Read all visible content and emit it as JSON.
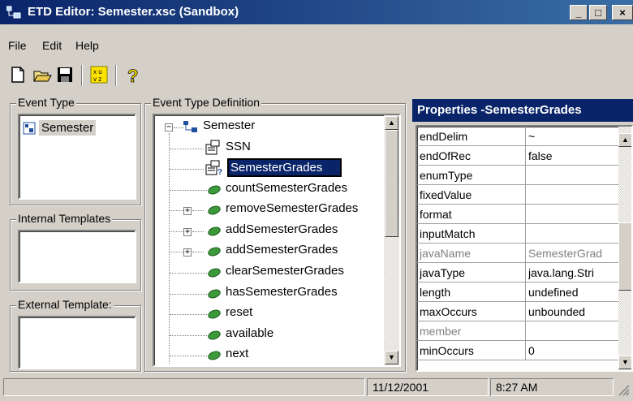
{
  "window": {
    "title": "ETD Editor: Semester.xsc (Sandbox)",
    "controls": [
      "minimize",
      "maximize",
      "close"
    ]
  },
  "menu": [
    "File",
    "Edit",
    "Help"
  ],
  "toolbar": {
    "icons": [
      "new-file-icon",
      "open-folder-icon",
      "save-icon",
      "grid-icon",
      "help-icon"
    ]
  },
  "event_type": {
    "label": "Event Type",
    "items": [
      {
        "label": "Semester",
        "selected": true
      }
    ]
  },
  "internal_templates": {
    "label": "Internal Templates"
  },
  "external_templates": {
    "label": "External Template:"
  },
  "definition": {
    "label": "Event Type Definition",
    "tree": [
      {
        "label": "Semester",
        "icon": "root-node-icon",
        "expanded": true
      },
      {
        "label": "SSN",
        "icon": "field-node-icon"
      },
      {
        "label": "SemesterGrades",
        "icon": "field-repeat-node-icon",
        "selected": true
      },
      {
        "label": "countSemesterGrades",
        "icon": "method-icon"
      },
      {
        "label": "removeSemesterGrades",
        "icon": "method-icon",
        "expandable": true
      },
      {
        "label": "addSemesterGrades",
        "icon": "method-icon",
        "expandable": true
      },
      {
        "label": "addSemesterGrades",
        "icon": "method-icon",
        "expandable": true
      },
      {
        "label": "clearSemesterGrades",
        "icon": "method-icon"
      },
      {
        "label": "hasSemesterGrades",
        "icon": "method-icon"
      },
      {
        "label": "reset",
        "icon": "method-icon"
      },
      {
        "label": "available",
        "icon": "method-icon"
      },
      {
        "label": "next",
        "icon": "method-icon"
      }
    ]
  },
  "properties": {
    "title": "Properties -SemesterGrades",
    "rows": [
      {
        "name": "endDelim",
        "value": "~"
      },
      {
        "name": "endOfRec",
        "value": "false"
      },
      {
        "name": "enumType",
        "value": ""
      },
      {
        "name": "fixedValue",
        "value": ""
      },
      {
        "name": "format",
        "value": ""
      },
      {
        "name": "inputMatch",
        "value": ""
      },
      {
        "name": "javaName",
        "value": "SemesterGrad",
        "disabled": true
      },
      {
        "name": "javaType",
        "value": "java.lang.Stri"
      },
      {
        "name": "length",
        "value": "undefined"
      },
      {
        "name": "maxOccurs",
        "value": "unbounded"
      },
      {
        "name": "member",
        "value": "",
        "disabled": true
      },
      {
        "name": "minOccurs",
        "value": "0"
      }
    ]
  },
  "status": {
    "date": "11/12/2001",
    "time": "8:27 AM"
  },
  "colors": {
    "titlebar": "#0a246a",
    "face": "#d4d0c8",
    "selection": "#0a246a"
  }
}
